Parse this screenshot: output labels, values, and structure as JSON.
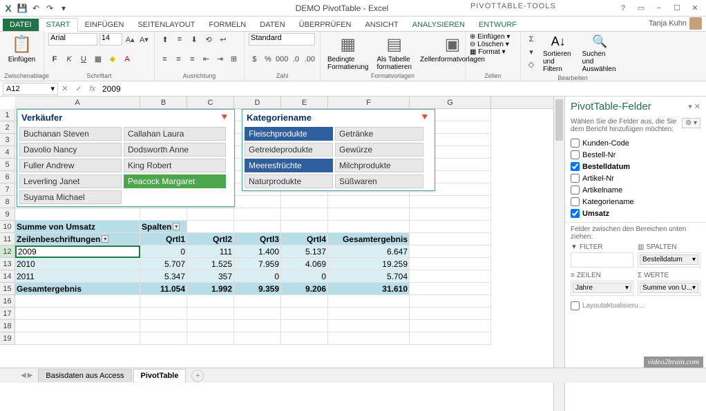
{
  "app": {
    "title": "DEMO PivotTable - Excel",
    "tools_title": "PIVOTTABLE-TOOLS"
  },
  "user": {
    "name": "Tanja Kuhn"
  },
  "ribbon_tabs": {
    "datei": "DATEI",
    "start": "START",
    "einfuegen": "EINFÜGEN",
    "seitenlayout": "SEITENLAYOUT",
    "formeln": "FORMELN",
    "daten": "DATEN",
    "ueberpruefen": "ÜBERPRÜFEN",
    "ansicht": "ANSICHT",
    "analysieren": "ANALYSIEREN",
    "entwurf": "ENTWURF"
  },
  "ribbon": {
    "paste": "Einfügen",
    "clipboard": "Zwischenablage",
    "font_name": "Arial",
    "font_size": "14",
    "font": "Schriftart",
    "alignment": "Ausrichtung",
    "number_format": "Standard",
    "number": "Zahl",
    "cond_fmt": "Bedingte Formatierung",
    "as_table": "Als Tabelle formatieren",
    "cell_styles": "Zellenformatvorlagen",
    "styles": "Formatvorlagen",
    "insert": "Einfügen",
    "delete": "Löschen",
    "format": "Format",
    "cells": "Zellen",
    "sort_filter": "Sortieren und Filtern",
    "find_select": "Suchen und Auswählen",
    "editing": "Bearbeiten"
  },
  "name_box": "A12",
  "formula": "2009",
  "columns": [
    "A",
    "B",
    "C",
    "D",
    "E",
    "F",
    "G"
  ],
  "slicer1": {
    "title": "Verkäufer",
    "items": [
      "Buchanan Steven",
      "Callahan Laura",
      "Davolio Nancy",
      "Dodsworth Anne",
      "Fuller Andrew",
      "King Robert",
      "Leverling Janet",
      "Peacock Margaret",
      "Suyama Michael"
    ],
    "selected_green": 7
  },
  "slicer2": {
    "title": "Kategoriename",
    "items": [
      "Fleischprodukte",
      "Getränke",
      "Getreideprodukte",
      "Gewürze",
      "Meeresfrüchte",
      "Milchprodukte",
      "Naturprodukte",
      "Süßwaren"
    ],
    "selected_blue": [
      0,
      4
    ]
  },
  "pivot": {
    "sum_label": "Summe von Umsatz",
    "col_label": "Spalten",
    "row_label": "Zeilenbeschriftungen",
    "cols": [
      "Qrtl1",
      "Qrtl2",
      "Qrtl3",
      "Qrtl4",
      "Gesamtergebnis"
    ],
    "rows": [
      {
        "label": "2009",
        "vals": [
          "0",
          "111",
          "1.400",
          "5.137",
          "6.647"
        ]
      },
      {
        "label": "2010",
        "vals": [
          "5.707",
          "1.525",
          "7.959",
          "4.069",
          "19.259"
        ]
      },
      {
        "label": "2011",
        "vals": [
          "5.347",
          "357",
          "0",
          "0",
          "5.704"
        ]
      }
    ],
    "total_label": "Gesamtergebnis",
    "totals": [
      "11.054",
      "1.992",
      "9.359",
      "9.206",
      "31.610"
    ]
  },
  "field_pane": {
    "title": "PivotTable-Felder",
    "subtitle": "Wählen Sie die Felder aus, die Sie dem Bericht hinzufügen möchten:",
    "fields": [
      {
        "label": "Kunden-Code",
        "checked": false
      },
      {
        "label": "Bestell-Nr",
        "checked": false
      },
      {
        "label": "Bestelldatum",
        "checked": true,
        "bold": true
      },
      {
        "label": "Artikel-Nr",
        "checked": false
      },
      {
        "label": "Artikelname",
        "checked": false
      },
      {
        "label": "Kategoriename",
        "checked": false
      },
      {
        "label": "Umsatz",
        "checked": true,
        "bold": true
      }
    ],
    "drag_label": "Felder zwischen den Bereichen unten ziehen:",
    "areas": {
      "filter": "FILTER",
      "columns": "SPALTEN",
      "rows": "ZEILEN",
      "values": "WERTE",
      "col_item": "Bestelldatum",
      "row_item": "Jahre",
      "val_item": "Summe von U..."
    },
    "defer": "Layoutaktualisieru..."
  },
  "sheets": {
    "s1": "Basisdaten aus Access",
    "s2": "PivotTable"
  },
  "watermark": "video2brain.com",
  "chart_data": {
    "type": "table",
    "title": "Summe von Umsatz",
    "columns": [
      "Qrtl1",
      "Qrtl2",
      "Qrtl3",
      "Qrtl4",
      "Gesamtergebnis"
    ],
    "rows": [
      "2009",
      "2010",
      "2011",
      "Gesamtergebnis"
    ],
    "data": [
      [
        0,
        111,
        1400,
        5137,
        6647
      ],
      [
        5707,
        1525,
        7959,
        4069,
        19259
      ],
      [
        5347,
        357,
        0,
        0,
        5704
      ],
      [
        11054,
        1992,
        9359,
        9206,
        31610
      ]
    ]
  }
}
